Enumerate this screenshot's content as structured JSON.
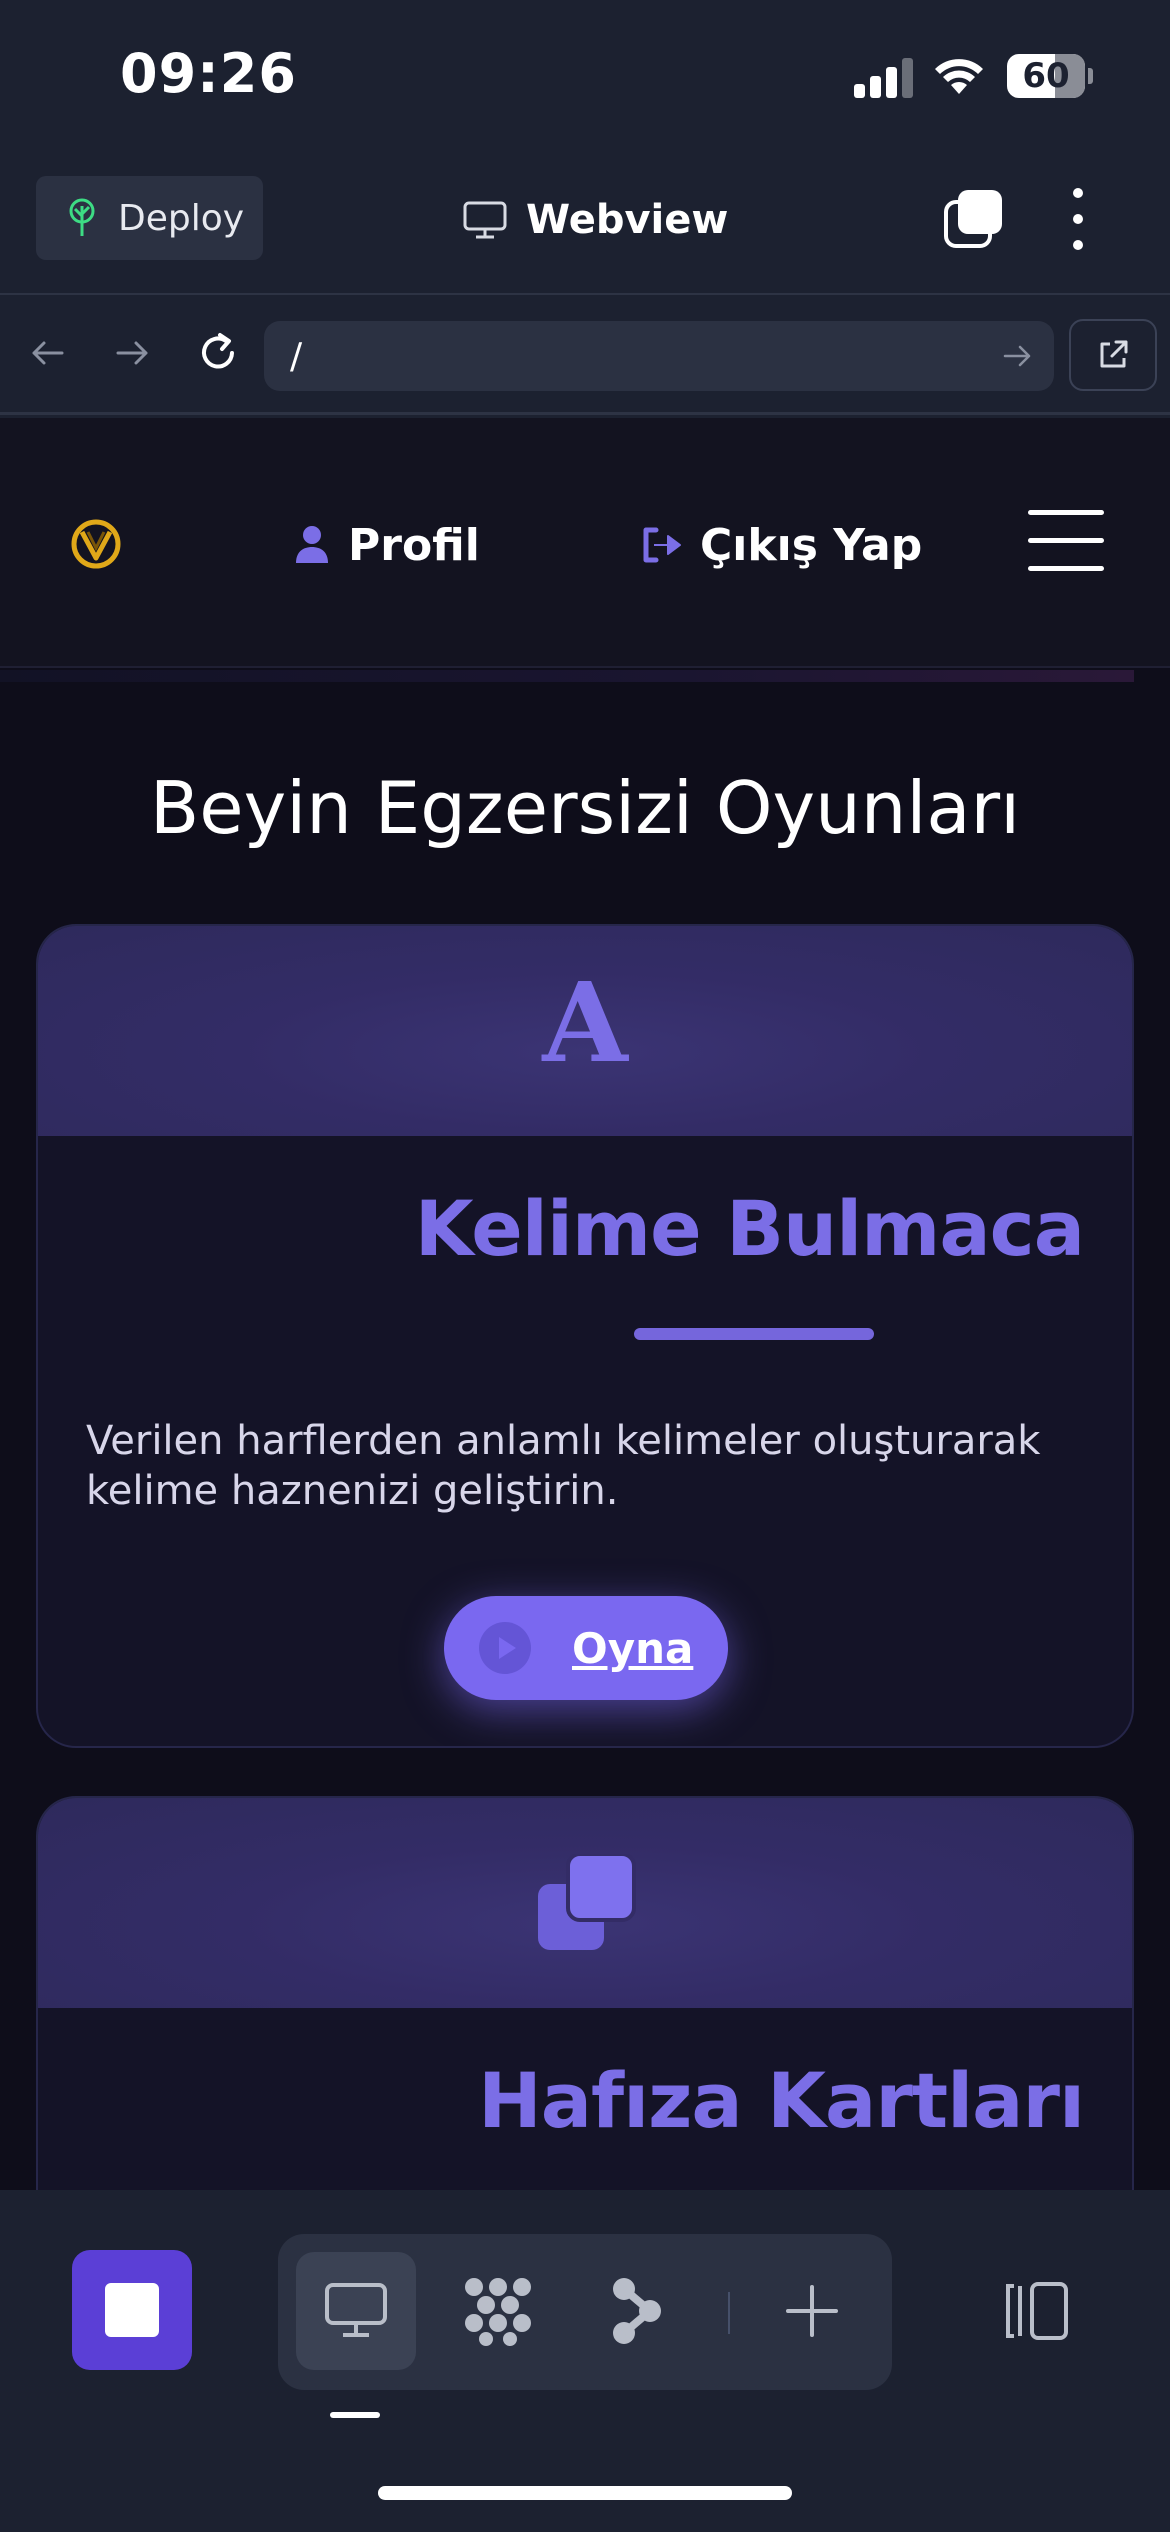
{
  "status_bar": {
    "time": "09:26",
    "battery": "60"
  },
  "toolbar": {
    "deploy_label": "Deploy",
    "title": "Webview"
  },
  "urlbar": {
    "url": "/"
  },
  "site": {
    "nav": {
      "profile_label": "Profil",
      "logout_label": "Çıkış Yap"
    },
    "page_title": "Beyin Egzersizi Oyunları",
    "games": [
      {
        "icon_letter": "A",
        "title": "Kelime Bulmaca",
        "description": "Verilen harflerden anlamlı kelimeler oluşturarak kelime haznenizi geliştirin.",
        "play_label": "Oyna"
      },
      {
        "title": "Hafıza Kartları"
      }
    ]
  },
  "colors": {
    "accent": "#7b6ee6",
    "stop_button": "#5b3fd6",
    "deploy_icon": "#3ddc84"
  },
  "icons": {
    "deploy": "tree-icon",
    "webview": "monitor-icon",
    "profile": "user-icon",
    "logout": "logout-icon",
    "game_2": "cards-icon"
  }
}
